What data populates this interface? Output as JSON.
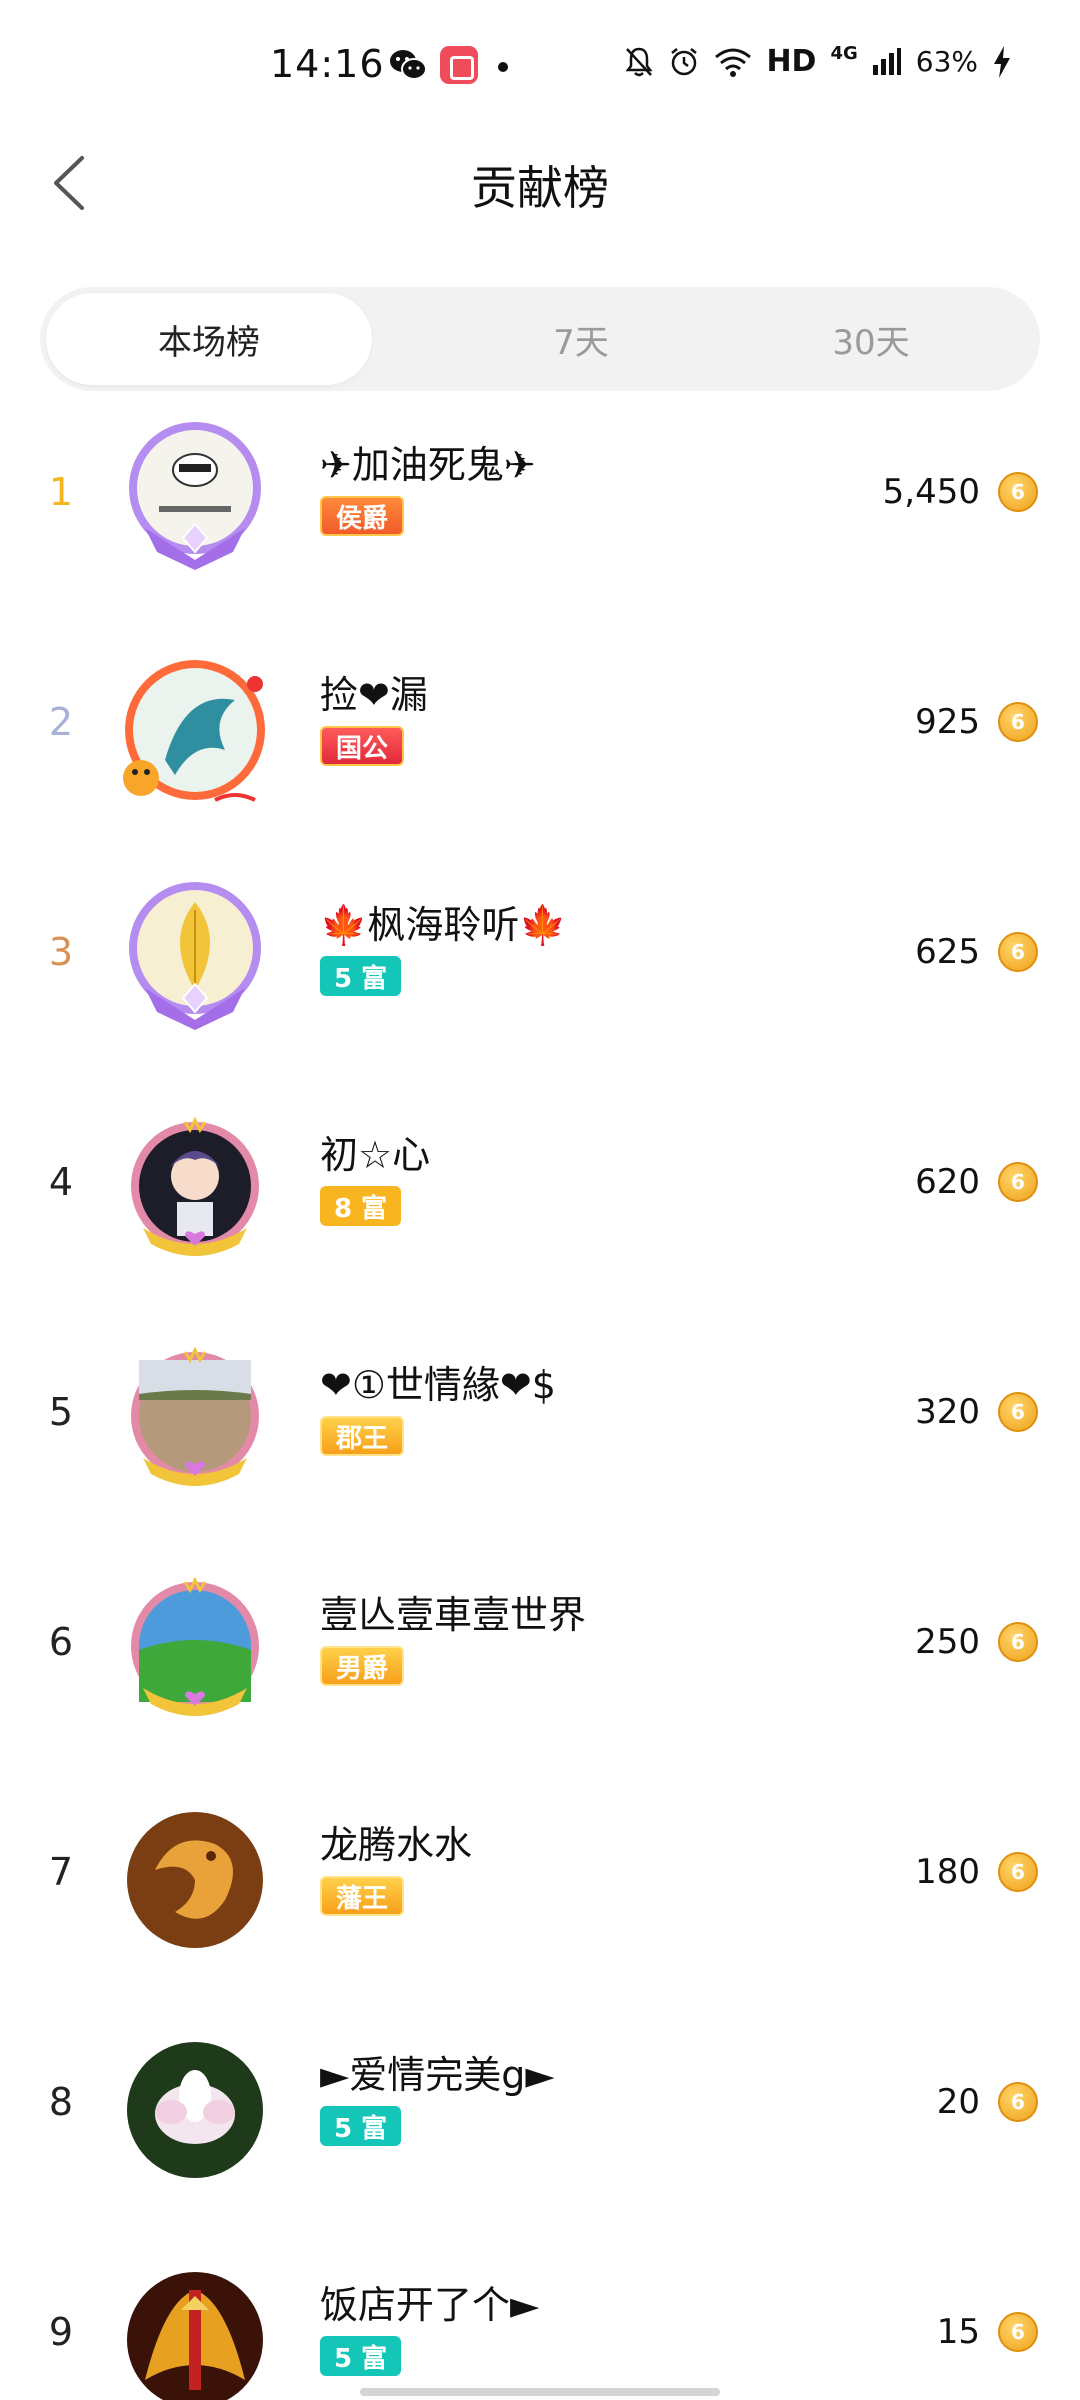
{
  "status_bar": {
    "time": "14:16",
    "hd": "HD",
    "network": "4G",
    "battery": "63%"
  },
  "header": {
    "title": "贡献榜"
  },
  "tabs": [
    {
      "label": "本场榜",
      "active": true
    },
    {
      "label": "7天",
      "active": false
    },
    {
      "label": "30天",
      "active": false
    }
  ],
  "coin_icon": "coin-icon",
  "rankings": [
    {
      "rank": "1",
      "name": "✈加油死鬼✈",
      "badge": "侯爵",
      "score": "5,450"
    },
    {
      "rank": "2",
      "name": "捡❤漏",
      "badge": "国公",
      "score": "925"
    },
    {
      "rank": "3",
      "name": "🍁枫海聆听🍁",
      "badge": "5 富",
      "score": "625"
    },
    {
      "rank": "4",
      "name": "初☆心",
      "badge": "8 富",
      "score": "620"
    },
    {
      "rank": "5",
      "name": "❤①世情緣❤$",
      "badge": "郡王",
      "score": "320"
    },
    {
      "rank": "6",
      "name": "壹亾壹車壹世界",
      "badge": "男爵",
      "score": "250"
    },
    {
      "rank": "7",
      "name": "龙腾水水",
      "badge": "藩王",
      "score": "180"
    },
    {
      "rank": "8",
      "name": "►爱情完美g►",
      "badge": "5 富",
      "score": "20"
    },
    {
      "rank": "9",
      "name": "饭店开了个►",
      "badge": "5 富",
      "score": "15"
    }
  ],
  "colors": {
    "rank_gold": "#f4b51e",
    "rank_silver": "#a9b0d6",
    "rank_bronze": "#d89255",
    "badge_teal": "#14c6b8",
    "badge_orange": "#f9b520",
    "coin": "#f0a21c"
  }
}
